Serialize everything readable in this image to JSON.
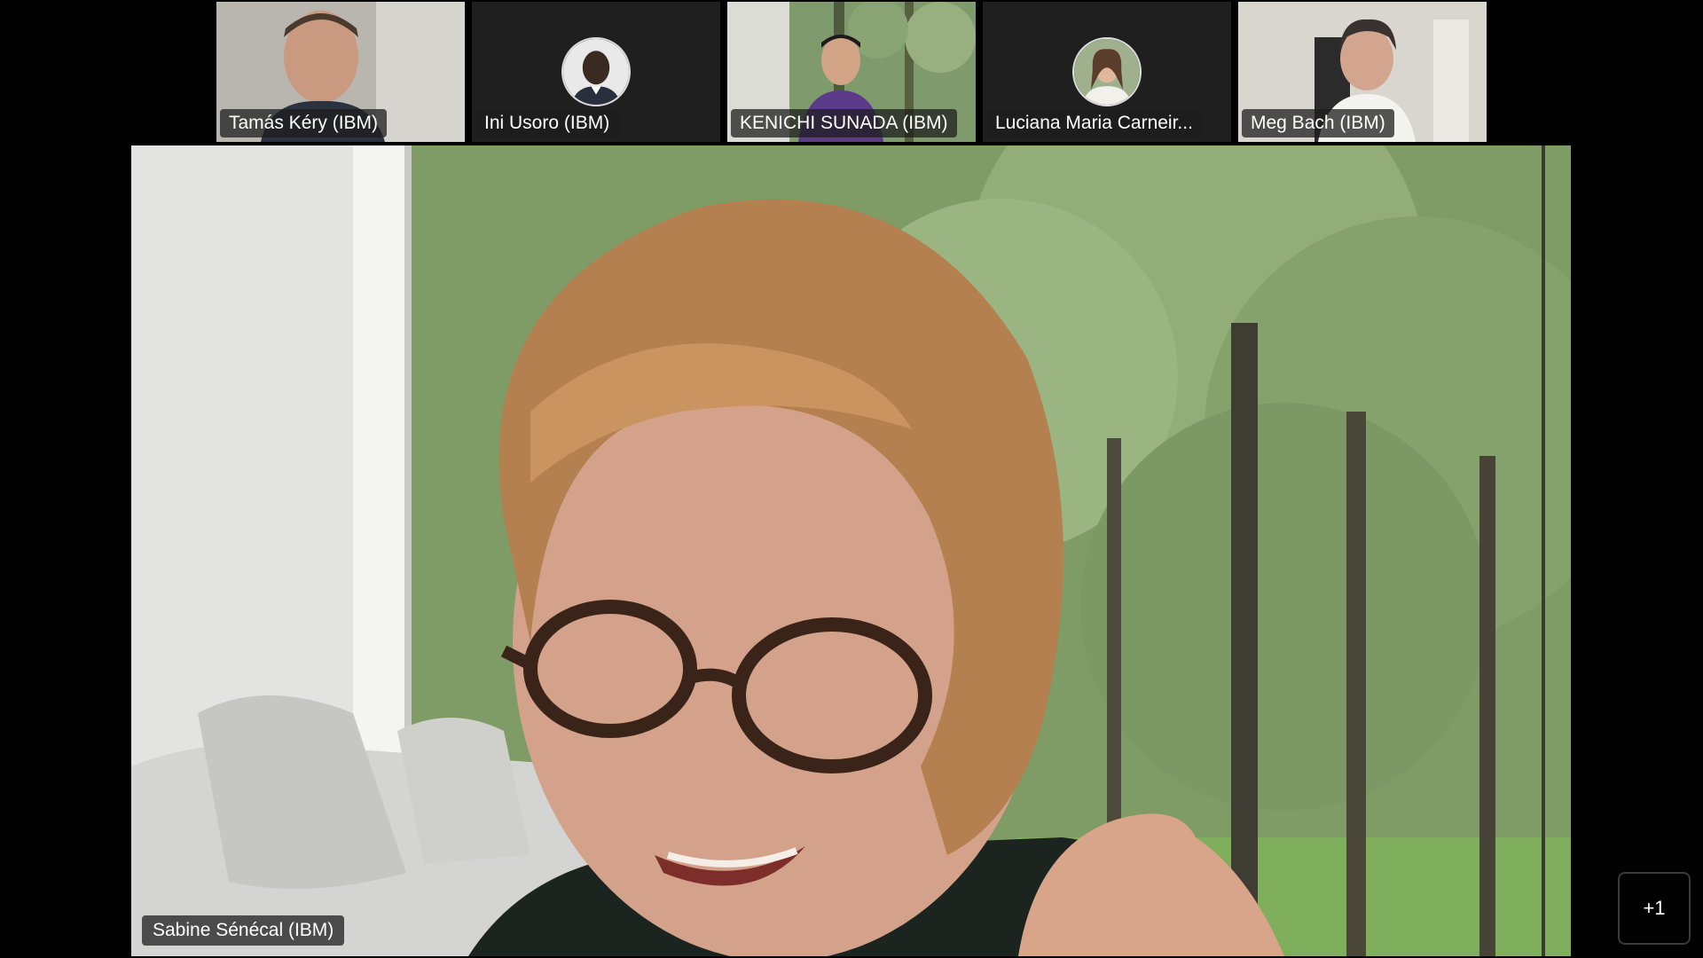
{
  "participants": [
    {
      "name": "Tamás Kéry (IBM)",
      "mode": "video"
    },
    {
      "name": "Ini Usoro (IBM)",
      "mode": "avatar"
    },
    {
      "name": "KENICHI SUNADA (IBM)",
      "mode": "video"
    },
    {
      "name": "Luciana Maria Carneir...",
      "mode": "avatar"
    },
    {
      "name": "Meg Bach (IBM)",
      "mode": "video"
    }
  ],
  "active_speaker": {
    "name": "Sabine Sénécal (IBM)"
  },
  "more_participants": {
    "label": "+1"
  },
  "colors": {
    "background": "#000000",
    "tile": "#1f1f1f",
    "name_badge": "rgba(30,30,30,0.75)"
  }
}
